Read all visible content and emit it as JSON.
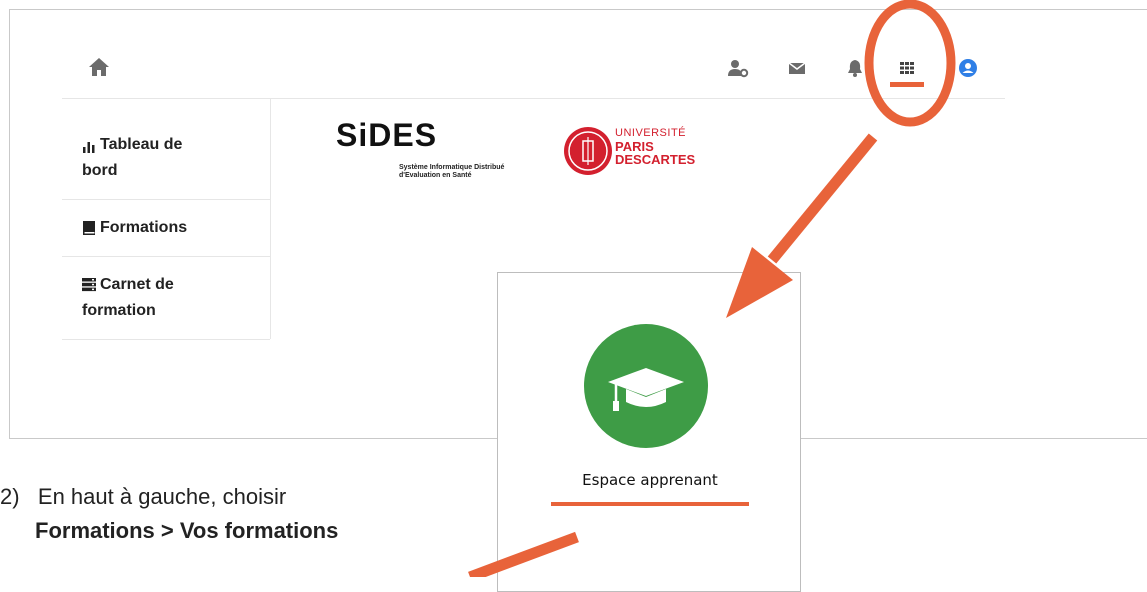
{
  "sidebar": {
    "items": [
      {
        "label_line1": "Tableau de",
        "label_line2": "bord",
        "icon": "bar-chart-icon"
      },
      {
        "label_line1": "Formations",
        "label_line2": "",
        "icon": "book-icon"
      },
      {
        "label_line1": "Carnet de",
        "label_line2": "formation",
        "icon": "server-icon"
      }
    ]
  },
  "topbar": {
    "icons": [
      "home-icon",
      "user-cog-icon",
      "envelope-icon",
      "bell-icon",
      "grid-icon",
      "user-circle-icon"
    ]
  },
  "logos": {
    "sides_title": "SiDES",
    "sides_sub1": "Système Informatique Distribué",
    "sides_sub2": "d'Evaluation en Santé",
    "univ_line1": "UNIVERSITÉ",
    "univ_line2": "PARIS",
    "univ_line3": "DESCARTES"
  },
  "popup": {
    "label": "Espace apprenant",
    "icon": "graduation-cap-icon"
  },
  "instruction": {
    "number": "2)",
    "line1": "En haut à gauche, choisir",
    "line2": "Formations > Vos formations"
  },
  "colors": {
    "annotation": "#e8633a",
    "cap_circle": "#3e9c46",
    "univ_red": "#d3202e",
    "icon_gray": "#6b6b6b"
  }
}
